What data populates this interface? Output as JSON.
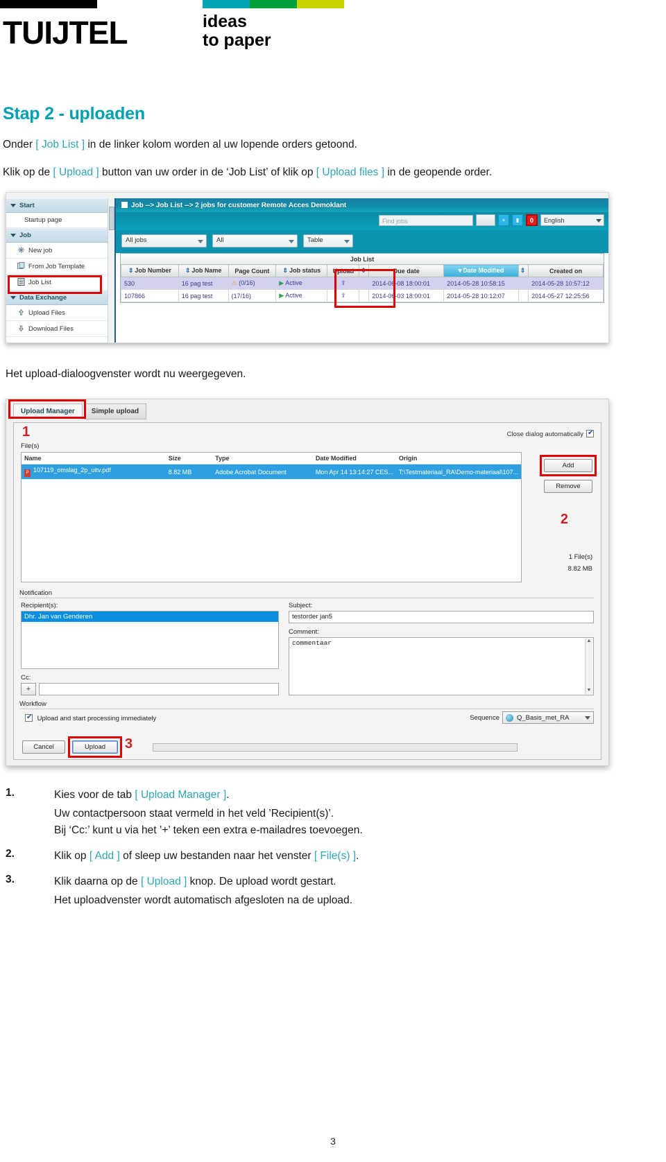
{
  "brand": {
    "logo_word": "TUIJTEL",
    "tagline_line1": "ideas",
    "tagline_line2": "to paper",
    "bar_colors": {
      "black": "#000000",
      "teal": "#00a3b4",
      "green": "#00a03c",
      "lime": "#c8d400"
    }
  },
  "accent_color": "#00a0b0",
  "highlight_color": "#e00000",
  "page": {
    "title": "Stap 2 - uploaden",
    "intro_1_a": "Onder ",
    "intro_1_ref": "[ Job List ]",
    "intro_1_b": " in de linker kolom worden al uw lopende orders getoond.",
    "intro_2_a": "Klik op de ",
    "intro_2_ref1": "[ Upload ]",
    "intro_2_b": " button van uw order in de ‘Job List’ of klik op ",
    "intro_2_ref2": "[ Upload files ]",
    "intro_2_c": " in de geopende order.",
    "mid_sentence": "Het upload-dialoogvenster wordt nu weergegeven.",
    "page_number": "3"
  },
  "joblist_shot": {
    "sidebar": [
      {
        "label": "Start",
        "type": "group"
      },
      {
        "label": "Startup page",
        "type": "item",
        "indent": true
      },
      {
        "label": "Job",
        "type": "group"
      },
      {
        "label": "New job",
        "type": "item",
        "icon": "star-icon"
      },
      {
        "label": "From Job Template",
        "type": "item",
        "icon": "template-icon"
      },
      {
        "label": "Job List",
        "type": "item",
        "icon": "list-icon",
        "highlighted": true
      },
      {
        "label": "Data Exchange",
        "type": "group"
      },
      {
        "label": "Upload Files",
        "type": "item",
        "icon": "upload-icon"
      },
      {
        "label": "Download Files",
        "type": "item",
        "icon": "download-icon"
      }
    ],
    "titlebar": "Job --> Job List --> 2 jobs for customer Remote Acces Demoklant",
    "find_placeholder": "Find jobs",
    "language": "English",
    "filters": [
      "All jobs",
      "All",
      "Table"
    ],
    "table_caption": "Job List",
    "columns": [
      "Job Number",
      "Job Name",
      "Page Count",
      "Job status",
      "Upload",
      "Due date",
      "Date Modified",
      "Created on"
    ],
    "rows": [
      {
        "job_number": "530",
        "job_name": "16 pag test",
        "page_count": "(0/16)",
        "page_count_warning": true,
        "job_status": "Active",
        "upload": "upload-icon",
        "due_date": "2014-06-08 18:00:01",
        "date_modified": "2014-05-28 10:58:15",
        "created_on": "2014-05-28 10:57:12"
      },
      {
        "job_number": "107866",
        "job_name": "16 pag test",
        "page_count": "(17/16)",
        "page_count_warning": false,
        "job_status": "Active",
        "upload": "upload-icon",
        "due_date": "2014-06-03 18:00:01",
        "date_modified": "2014-05-28 10:12:07",
        "created_on": "2014-05-27 12:25:56"
      }
    ]
  },
  "upload_shot": {
    "tabs": [
      {
        "label": "Upload Manager",
        "active": true
      },
      {
        "label": "Simple upload",
        "active": false
      }
    ],
    "callouts": {
      "one": "1",
      "two": "2",
      "three": "3"
    },
    "close_dialog_label": "Close dialog automatically",
    "close_dialog_checked": true,
    "files_label": "File(s)",
    "file_columns": [
      "Name",
      "Size",
      "Type",
      "Date Modified",
      "Origin"
    ],
    "file_rows": [
      {
        "name": "107119_omslag_2p_uitv.pdf",
        "size": "8.82 MB",
        "type": "Adobe Acrobat Document",
        "date_modified": "Mon Apr 14 13:14:27 CES...",
        "origin": "T:\\Testmateriaal_RA\\Demo-materiaal\\107..."
      }
    ],
    "add_button": "Add",
    "remove_button": "Remove",
    "file_count": "1 File(s)",
    "file_total_size": "8.82 MB",
    "notification_label": "Notification",
    "recipients_label": "Recipient(s):",
    "recipient_selected": "Dhr. Jan van Genderen",
    "cc_label": "Cc:",
    "cc_add_button": "+",
    "cc_value": "",
    "subject_label": "Subject:",
    "subject_value": "testorder jan5",
    "comment_label": "Comment:",
    "comment_value": "commentaar",
    "workflow_label": "Workflow",
    "workflow_checkbox_label": "Upload and start processing immediately",
    "workflow_checked": true,
    "sequence_label": "Sequence",
    "sequence_value": "Q_Basis_met_RA",
    "cancel_button": "Cancel",
    "upload_button": "Upload"
  },
  "instructions": [
    {
      "num": "1.",
      "line_a": "Kies voor de tab ",
      "ref": "[ Upload Manager ]",
      "line_b": ".",
      "sub": [
        "Uw contactpersoon staat vermeld in het veld ’Recipient(s)’.",
        "Bij ‘Cc:’ kunt u via het ’+’ teken een extra e-mailadres toevoegen."
      ]
    },
    {
      "num": "2.",
      "line_a": "Klik op ",
      "ref": "[ Add ]",
      "line_b": " of sleep uw bestanden naar het venster ",
      "ref2": "[ File(s) ]",
      "line_c": ".",
      "sub": []
    },
    {
      "num": "3.",
      "line_a": "Klik daarna op de ",
      "ref": "[ Upload ]",
      "line_b": " knop. De upload wordt gestart.",
      "sub": [
        "Het uploadvenster wordt automatisch afgesloten na de upload."
      ]
    }
  ]
}
